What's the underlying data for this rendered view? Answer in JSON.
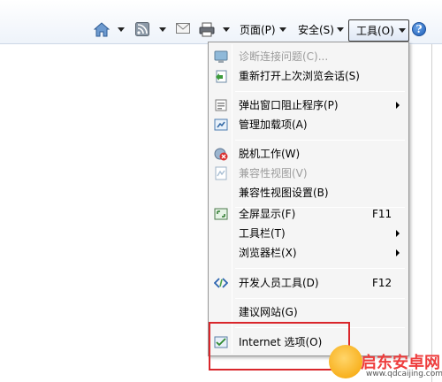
{
  "toolbar": {
    "page_label": "页面(P)",
    "safety_label": "安全(S)",
    "tools_label": "工具(O)",
    "help_icon": "help-icon",
    "help_glyph": "?"
  },
  "menu": {
    "items": [
      {
        "label": "诊断连接问题(C)...",
        "disabled": true,
        "icon": "diagnose-icon"
      },
      {
        "label": "重新打开上次浏览会话(S)",
        "icon": "reopen-session-icon"
      },
      {
        "label": "弹出窗口阻止程序(P)",
        "submenu": true,
        "icon": "popup-blocker-icon"
      },
      {
        "label": "管理加载项(A)",
        "icon": "addons-icon"
      },
      {
        "label": "脱机工作(W)",
        "icon": "offline-icon"
      },
      {
        "label": "兼容性视图(V)",
        "disabled": true,
        "icon": "compat-view-icon"
      },
      {
        "label": "兼容性视图设置(B)"
      },
      {
        "label": "全屏显示(F)",
        "shortcut": "F11",
        "icon": "fullscreen-icon"
      },
      {
        "label": "工具栏(T)",
        "submenu": true
      },
      {
        "label": "浏览器栏(X)",
        "submenu": true
      },
      {
        "label": "开发人员工具(D)",
        "shortcut": "F12",
        "icon": "dev-tools-icon"
      },
      {
        "label": "建议网站(G)"
      },
      {
        "label": "Internet 选项(O)",
        "icon": "internet-options-icon"
      }
    ]
  },
  "watermark": {
    "text": "启东安卓网",
    "url": "www.qdcaijing.com"
  },
  "colors": {
    "highlight_box": "#d9262b",
    "disabled_text": "#9c9c9c"
  }
}
